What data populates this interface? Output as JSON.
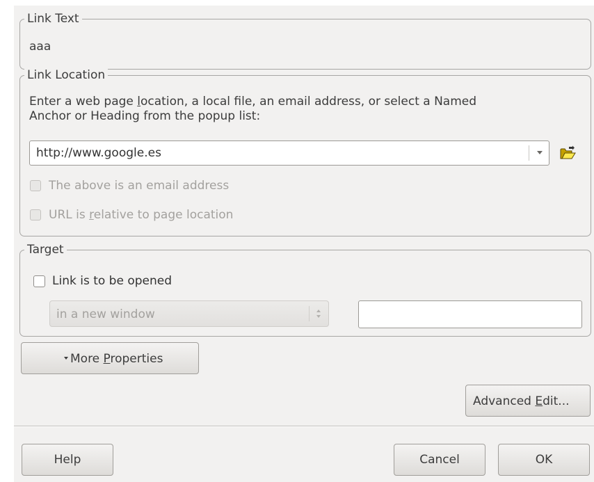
{
  "link_text": {
    "title": "Link Text",
    "value": "aaa"
  },
  "link_location": {
    "title": "Link Location",
    "desc_before": "Enter a web page ",
    "desc_underlined": "l",
    "desc_after": "ocation, a local file, an email address, or select a Named",
    "desc_line2": "Anchor or Heading from the popup list:",
    "url_value": "http://www.google.es",
    "email_checkbox_label": "The above is an email address",
    "relative_label_before": "URL is ",
    "relative_label_underlined": "r",
    "relative_label_after": "elative to page location"
  },
  "target": {
    "title": "Target",
    "checkbox_label": "Link is to be opened",
    "window_select_value": "in a new window",
    "frame_input_value": ""
  },
  "more_properties": {
    "label_before": "More ",
    "label_underlined": "P",
    "label_after": "roperties"
  },
  "advanced_edit": {
    "label_before": "Advanced ",
    "label_underlined": "E",
    "label_after": "dit..."
  },
  "footer": {
    "help": "Help",
    "cancel": "Cancel",
    "ok": "OK"
  }
}
